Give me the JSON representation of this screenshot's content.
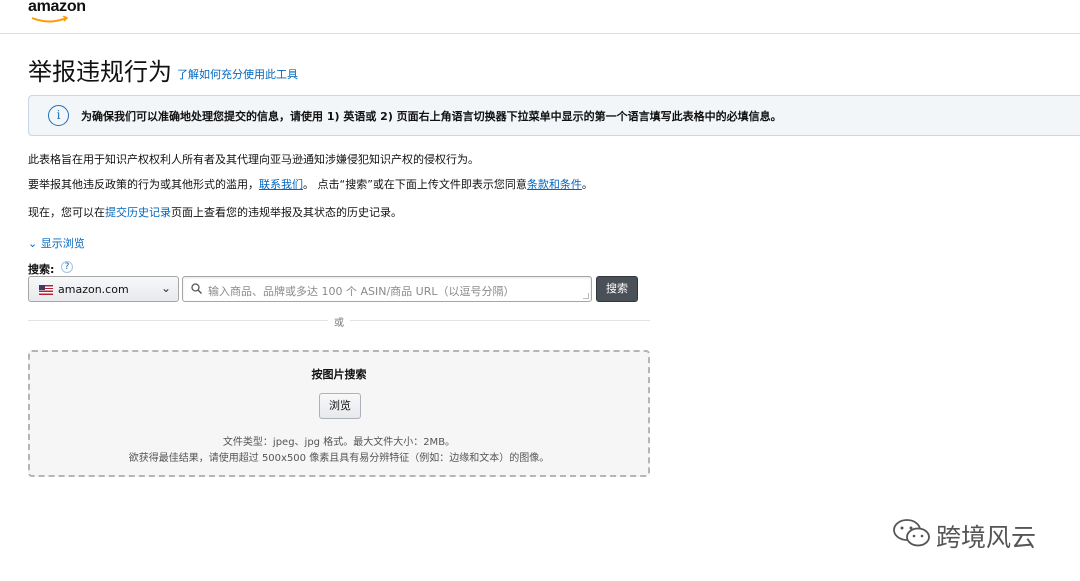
{
  "header": {
    "logo_text": "amazon"
  },
  "page": {
    "title": "举报违规行为",
    "title_link": "了解如何充分使用此工具"
  },
  "info": {
    "icon_glyph": "i",
    "text": "为确保我们可以准确地处理您提交的信息，请使用 1) 英语或 2) 页面右上角语言切换器下拉菜单中显示的第一个语言填写此表格中的必填信息。"
  },
  "intro": {
    "line1": "此表格旨在用于知识产权权利人所有者及其代理向亚马逊通知涉嫌侵犯知识产权的侵权行为。",
    "line2_pre": "要举报其他违反政策的行为或其他形式的滥用，",
    "line2_link": "联系我们",
    "line2_mid": "。 点击“搜索”或在下面上传文件即表示您同意",
    "line2_link2": "条款和条件",
    "line2_post": "。",
    "line3_pre": "现在，您可以在",
    "line3_link": "提交历史记录",
    "line3_post": "页面上查看您的违规举报及其状态的历史记录。"
  },
  "browse_toggle": "显示浏览",
  "search": {
    "label": "搜索:",
    "help": "?",
    "marketplace": "amazon.com",
    "placeholder": "输入商品、品牌或多达 100 个 ASIN/商品 URL（以逗号分隔）",
    "button": "搜索"
  },
  "or_text": "或",
  "image_search": {
    "title": "按图片搜索",
    "browse_button": "浏览",
    "note1": "文件类型：jpeg、jpg 格式。最大文件大小：2MB。",
    "note2": "欲获得最佳结果，请使用超过 500x500 像素且具有易分辨特征（例如：边缘和文本）的图像。"
  },
  "watermark": {
    "text": "跨境风云",
    "icon": "wechat-icon"
  },
  "colors": {
    "link": "#0066c0",
    "info_bg": "#f3f6f9",
    "search_button": "#4a5058"
  }
}
